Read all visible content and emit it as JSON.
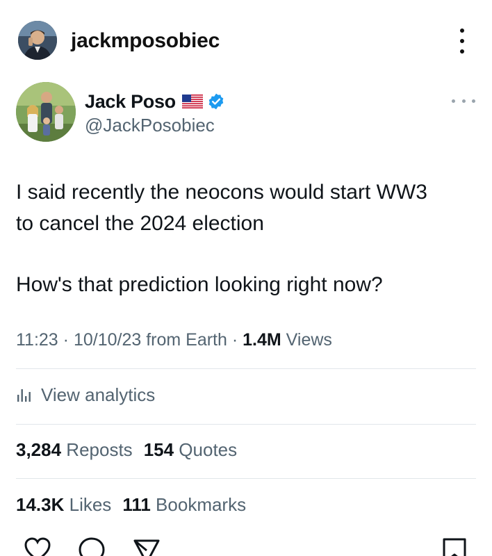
{
  "instagram_header": {
    "username": "jackmposobiec",
    "avatar_icon": "profile-photo",
    "more_icon": "vertical-ellipsis-icon"
  },
  "tweet": {
    "display_name": "Jack Poso",
    "flag_icon": "us-flag-icon",
    "verified_icon": "verified-badge-icon",
    "verified_color": "#1d9bf0",
    "handle": "@JackPosobiec",
    "more_icon": "horizontal-ellipsis-icon",
    "text_line1": "I said recently the neocons would start WW3",
    "text_line2": "to cancel the 2024 election",
    "text_line3": "How's that prediction looking right now?",
    "meta": {
      "time": "11:23",
      "sep1": " · ",
      "date": "10/10/23",
      "source": " from Earth",
      "sep2": " · ",
      "views_count": "1.4M",
      "views_label": " Views"
    },
    "analytics_label": "View analytics",
    "stats": {
      "reposts_count": "3,284",
      "reposts_label": " Reposts",
      "quotes_count": "154",
      "quotes_label": " Quotes",
      "likes_count": "14.3K",
      "likes_label": " Likes",
      "bookmarks_count": "111",
      "bookmarks_label": " Bookmarks"
    },
    "action_icons": [
      "heart-icon",
      "reply-icon",
      "share-icon",
      "bookmark-icon"
    ]
  },
  "colors": {
    "text_primary": "#0f1419",
    "text_secondary": "#536471",
    "divider": "#e1e6ea"
  }
}
